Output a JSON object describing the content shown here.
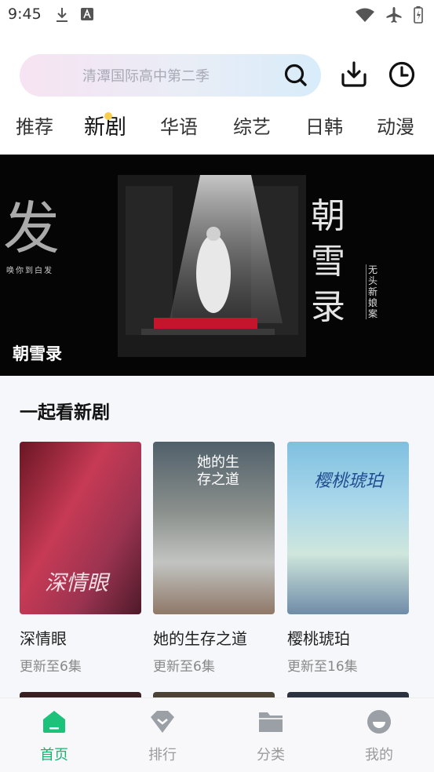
{
  "status": {
    "time": "9:45"
  },
  "search": {
    "placeholder": "清潭国际高中第二季"
  },
  "tabs": [
    {
      "label": "推荐"
    },
    {
      "label": "新剧"
    },
    {
      "label": "华语"
    },
    {
      "label": "综艺"
    },
    {
      "label": "日韩"
    },
    {
      "label": "动漫"
    }
  ],
  "banner": {
    "title": "朝雪录",
    "art_text_left": "发",
    "art_text_right": "朝雪录",
    "art_text_small": "唤你到白发",
    "art_tag": "无头新娘案"
  },
  "section": {
    "title": "一起看新剧"
  },
  "cards": [
    {
      "title": "深情眼",
      "subtitle": "更新至6集",
      "poster_text": "深情眼"
    },
    {
      "title": "她的生存之道",
      "subtitle": "更新至6集",
      "poster_text": "她的生存之道"
    },
    {
      "title": "樱桃琥珀",
      "subtitle": "更新至16集",
      "poster_text": "樱桃琥珀"
    }
  ],
  "nav": [
    {
      "label": "首页",
      "icon": "home-icon"
    },
    {
      "label": "排行",
      "icon": "rank-icon"
    },
    {
      "label": "分类",
      "icon": "folder-icon"
    },
    {
      "label": "我的",
      "icon": "profile-icon"
    }
  ],
  "colors": {
    "accent": "#17b46f",
    "tab_dot": "#f7cf4c"
  }
}
